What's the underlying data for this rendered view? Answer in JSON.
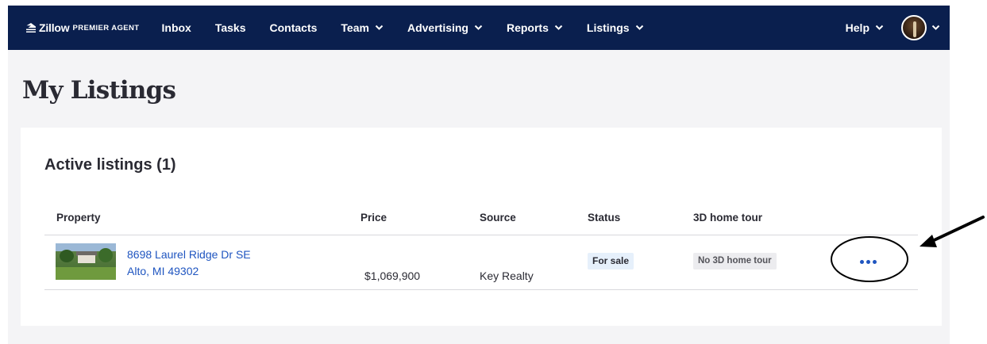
{
  "nav": {
    "brand": "Zillow",
    "brand_suffix": "PREMIER AGENT",
    "items": [
      {
        "label": "Inbox"
      },
      {
        "label": "Tasks"
      },
      {
        "label": "Contacts"
      },
      {
        "label": "Team"
      },
      {
        "label": "Advertising"
      },
      {
        "label": "Reports"
      },
      {
        "label": "Listings"
      }
    ],
    "help_label": "Help"
  },
  "page": {
    "title": "My Listings"
  },
  "listings": {
    "title": "Active listings (1)",
    "columns": [
      "Property",
      "Price",
      "Source",
      "Status",
      "3D home tour"
    ],
    "rows": [
      {
        "address_line1": "8698 Laurel Ridge Dr SE",
        "address_line2": "Alto, MI 49302",
        "price": "$1,069,900",
        "source": "Key Realty",
        "status": "For sale",
        "tour": "No 3D home tour"
      }
    ]
  },
  "icons": {
    "chevron": "chevron-down-icon",
    "more": "more-options-icon",
    "brand": "zillow-logo-icon",
    "avatar": "user-avatar"
  },
  "colors": {
    "navbar": "#0a1f4e",
    "link": "#1f55c0",
    "page_background": "#f4f4f6",
    "status_badge": "#e6f0fb",
    "annotation": "#000000"
  }
}
